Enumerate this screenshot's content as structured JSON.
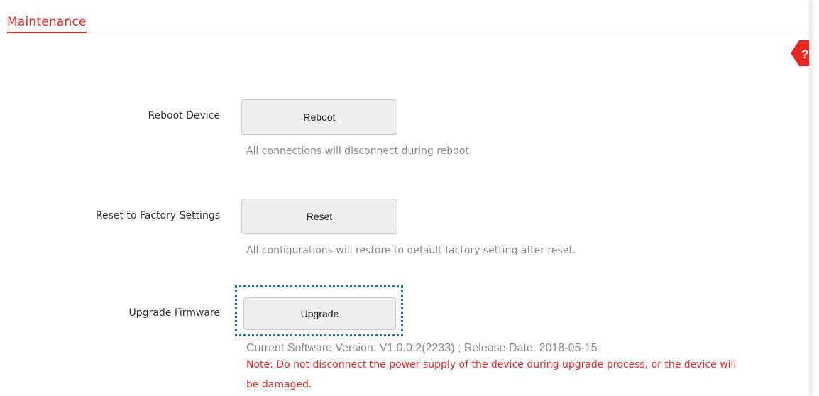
{
  "header": {
    "title": "Maintenance",
    "help_icon": "help-question-icon",
    "accent_color": "#e8251e"
  },
  "reboot": {
    "label": "Reboot Device",
    "button_label": "Reboot",
    "hint": "All connections will disconnect during reboot."
  },
  "reset": {
    "label": "Reset to Factory Settings",
    "button_label": "Reset",
    "hint": "All configurations will restore to default factory setting after reset."
  },
  "upgrade": {
    "label": "Upgrade Firmware",
    "button_label": "Upgrade",
    "version_info": "Current Software Version: V1.0.0.2(2233) ; Release Date: 2018-05-15",
    "note": "Note: Do not disconnect the power supply of the device during upgrade process, or the device will be damaged.",
    "note_color": "#e8251e",
    "focus_color": "#1f6fc0"
  }
}
